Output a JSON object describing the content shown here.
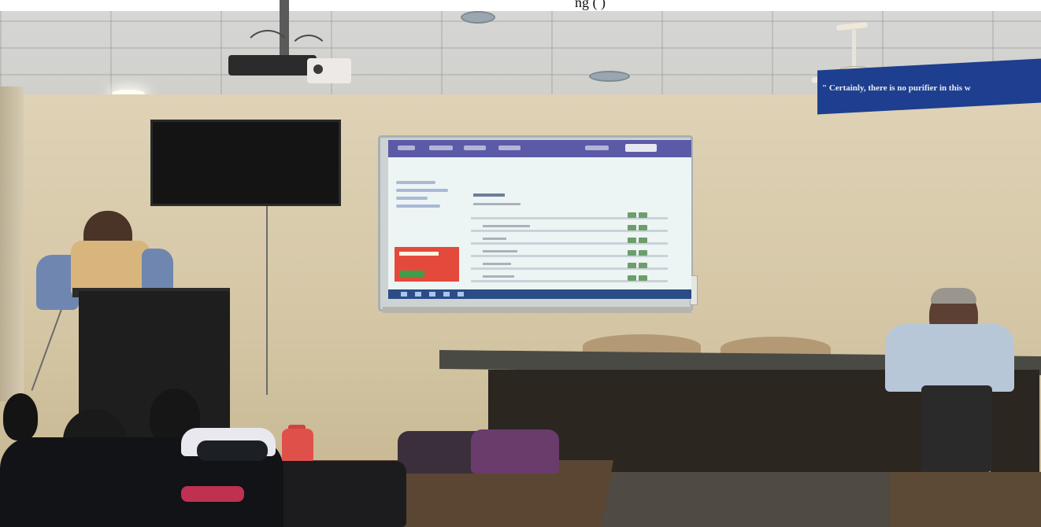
{
  "caption": {
    "text": "ng  (                    )"
  },
  "banner": {
    "text": "\" Certainly, there is no purifier in this w",
    "color": "#1e3f8f"
  },
  "colors": {
    "wall": "#d9cdb0",
    "projected_bar": "#5b5aa6",
    "ad_panel": "#e44a3c",
    "taskbar": "#2b4c86"
  }
}
